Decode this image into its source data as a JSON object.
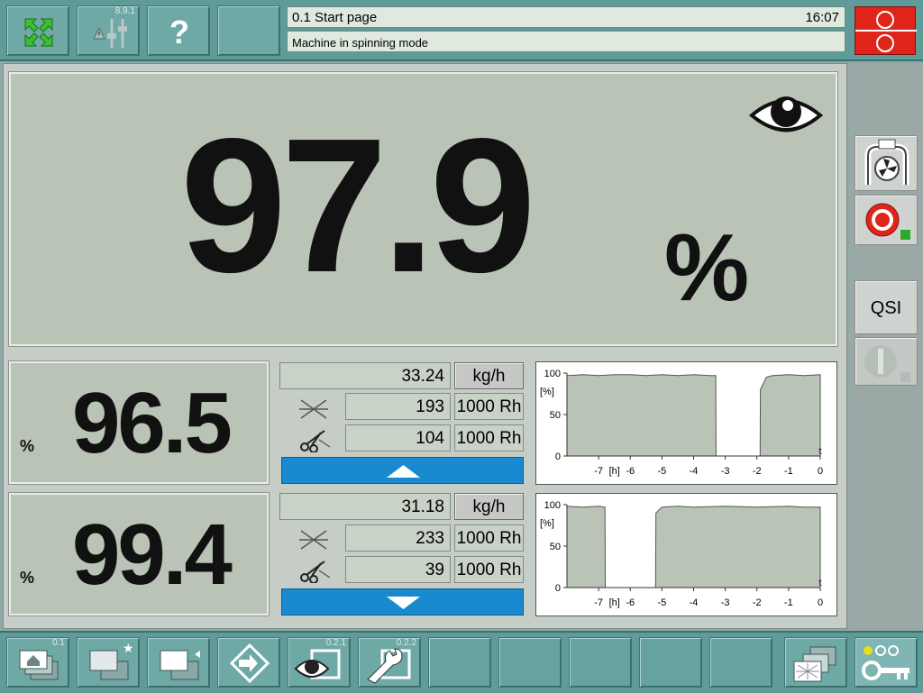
{
  "header": {
    "title": "0.1 Start page",
    "time": "16:07",
    "status": "Machine in spinning mode",
    "warnings_version": "8.9.1",
    "help_icon": "?"
  },
  "main": {
    "efficiency": {
      "value": "97.9",
      "unit": "%"
    },
    "sides": [
      {
        "efficiency": "96.5",
        "unit": "%",
        "production": "33.24",
        "production_unit": "kg/h",
        "ends_down": "193",
        "ends_down_unit": "1000 Rh",
        "cuts": "104",
        "cuts_unit": "1000 Rh",
        "arrow": "up"
      },
      {
        "efficiency": "99.4",
        "unit": "%",
        "production": "31.18",
        "production_unit": "kg/h",
        "ends_down": "233",
        "ends_down_unit": "1000 Rh",
        "cuts": "39",
        "cuts_unit": "1000 Rh",
        "arrow": "down"
      }
    ]
  },
  "chart_data": [
    {
      "type": "area",
      "ylabel": "[%]",
      "xlabel": "t",
      "x_unit_label": "[h]",
      "xlim": [
        -8,
        0
      ],
      "ylim": [
        0,
        100
      ],
      "y_ticks": [
        "100",
        "50",
        "0"
      ],
      "x_ticks": [
        "-7",
        "-6",
        "-5",
        "-4",
        "-3",
        "-2",
        "-1",
        "0"
      ],
      "x": [
        -8,
        -7.5,
        -7,
        -6.5,
        -6,
        -5.5,
        -5,
        -4.5,
        -4,
        -3.5,
        -3.3,
        -3.29,
        -1.9,
        -1.89,
        -1.7,
        -1.5,
        -1,
        -0.5,
        0
      ],
      "y": [
        97,
        98,
        97,
        98,
        98,
        97,
        98,
        97,
        98,
        97,
        97,
        0,
        0,
        80,
        95,
        97,
        98,
        97,
        98
      ]
    },
    {
      "type": "area",
      "ylabel": "[%]",
      "xlabel": "t",
      "x_unit_label": "[h]",
      "xlim": [
        -8,
        0
      ],
      "ylim": [
        0,
        100
      ],
      "y_ticks": [
        "100",
        "50",
        "0"
      ],
      "x_ticks": [
        "-7",
        "-6",
        "-5",
        "-4",
        "-3",
        "-2",
        "-1",
        "0"
      ],
      "x": [
        -8,
        -7.5,
        -7,
        -6.8,
        -6.79,
        -5.2,
        -5.19,
        -5.0,
        -4.5,
        -4,
        -3,
        -2,
        -1,
        -0.5,
        0
      ],
      "y": [
        98,
        97,
        98,
        97,
        0,
        0,
        90,
        97,
        98,
        97,
        98,
        97,
        98,
        97,
        97
      ]
    }
  ],
  "sidebar": {
    "qsi_label": "QSI"
  },
  "footer": {
    "versions": [
      "0.1",
      "0.2.1",
      "0.2.2"
    ]
  },
  "colors": {
    "frame": "#5f9c99",
    "panel": "#b9c3b6",
    "accent_blue": "#1a8ad0",
    "stop_red": "#e0241a",
    "chart_fill": "#b9c3b6"
  }
}
